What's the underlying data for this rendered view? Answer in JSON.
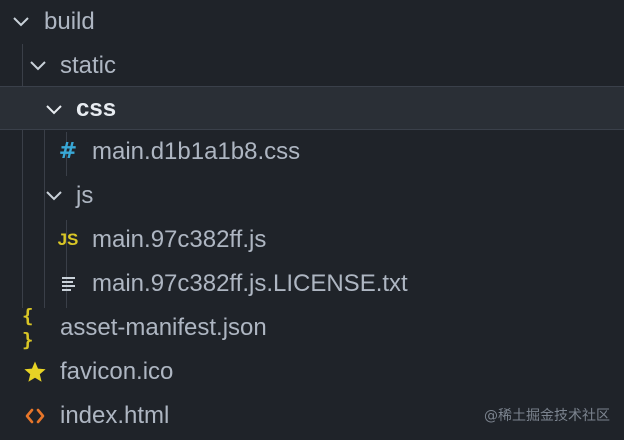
{
  "explorer": {
    "items": [
      {
        "label": "build",
        "kind": "folder",
        "expanded": true,
        "icon": "chevron-down-icon"
      },
      {
        "label": "static",
        "kind": "folder",
        "expanded": true,
        "icon": "chevron-down-icon"
      },
      {
        "label": "css",
        "kind": "folder",
        "expanded": true,
        "icon": "chevron-down-icon",
        "selected": true
      },
      {
        "label": "main.d1b1a1b8.css",
        "kind": "file",
        "icon": "css-hash-icon",
        "icon_glyph": "#",
        "icon_color": "#39a8d6"
      },
      {
        "label": "js",
        "kind": "folder",
        "expanded": true,
        "icon": "chevron-down-icon"
      },
      {
        "label": "main.97c382ff.js",
        "kind": "file",
        "icon": "javascript-icon",
        "icon_glyph": "JS",
        "icon_color": "#d9c626"
      },
      {
        "label": "main.97c382ff.js.LICENSE.txt",
        "kind": "file",
        "icon": "text-lines-icon",
        "icon_color": "#c9d1d9"
      },
      {
        "label": "asset-manifest.json",
        "kind": "file",
        "icon": "json-braces-icon",
        "icon_glyph": "{ }",
        "icon_color": "#d9c626"
      },
      {
        "label": "favicon.ico",
        "kind": "file",
        "icon": "star-icon",
        "icon_color": "#e7d325"
      },
      {
        "label": "index.html",
        "kind": "file",
        "icon": "html-brackets-icon",
        "icon_color": "#e7762a"
      }
    ]
  },
  "watermark": "@稀土掘金技术社区",
  "colors": {
    "background": "#1f2329",
    "selected_row": "#2a2f36",
    "text": "#aeb6c2",
    "selected_text": "#e8ecf1"
  }
}
